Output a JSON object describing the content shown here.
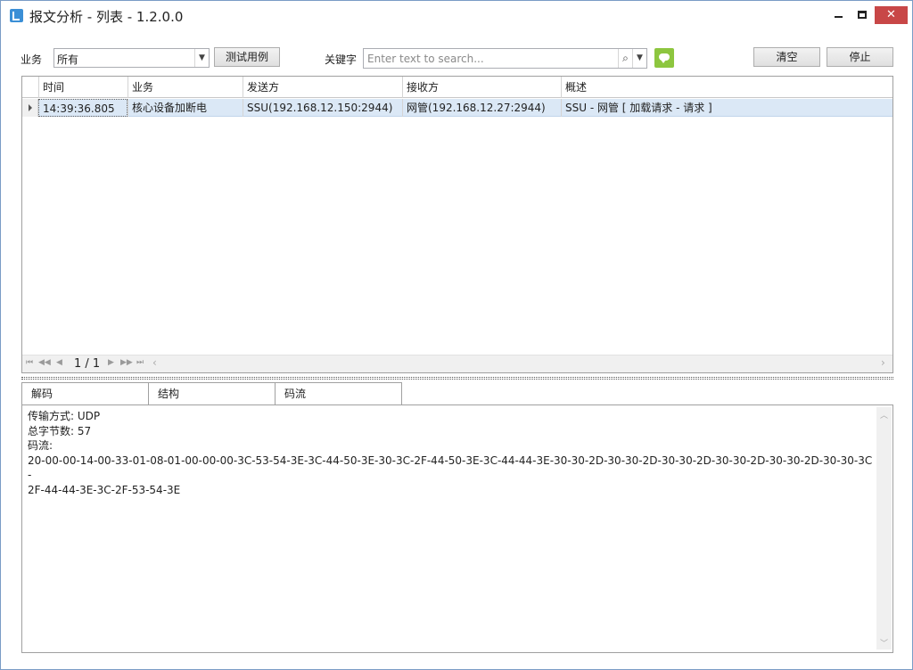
{
  "window": {
    "title": "报文分析 - 列表  -  1.2.0.0",
    "minimize_glyph": "minimize-icon",
    "maximize_glyph": "maximize-icon",
    "close_glyph": "✕"
  },
  "toolbar": {
    "business_label": "业务",
    "business_value": "所有",
    "test_case_button": "测试用例",
    "keyword_label": "关键字",
    "search_placeholder": "Enter text to search...",
    "search_icon": "⌕",
    "dropdown_glyph": "▼",
    "clear_button": "清空",
    "stop_button": "停止"
  },
  "grid": {
    "columns": [
      "时间",
      "业务",
      "发送方",
      "接收方",
      "概述"
    ],
    "rows": [
      [
        "14:39:36.805",
        "核心设备加断电",
        "SSU(192.168.12.150:2944)",
        "网管(192.168.12.27:2944)",
        "SSU - 网管 [ 加载请求 - 请求 ]"
      ]
    ],
    "pager": {
      "first": "⏮",
      "prev_page": "◀◀",
      "prev": "◀",
      "page": "1 / 1",
      "next": "▶",
      "next_page": "▶▶",
      "last": "⏭",
      "scroll_left": "‹",
      "scroll_right": "›"
    }
  },
  "tabs": [
    {
      "label": "解码",
      "active": false
    },
    {
      "label": "结构",
      "active": false
    },
    {
      "label": "码流",
      "active": true
    }
  ],
  "detail": {
    "line1": "传输方式: UDP",
    "line2": "总字节数: 57",
    "line3": "码流:",
    "line4": "20-00-00-14-00-33-01-08-01-00-00-00-3C-53-54-3E-3C-44-50-3E-30-3C-2F-44-50-3E-3C-44-44-3E-30-30-2D-30-30-2D-30-30-2D-30-30-2D-30-30-2D-30-30-3C-",
    "line5": "2F-44-44-3E-3C-2F-53-54-3E",
    "scroll_up": "︿",
    "scroll_down": "﹀"
  }
}
